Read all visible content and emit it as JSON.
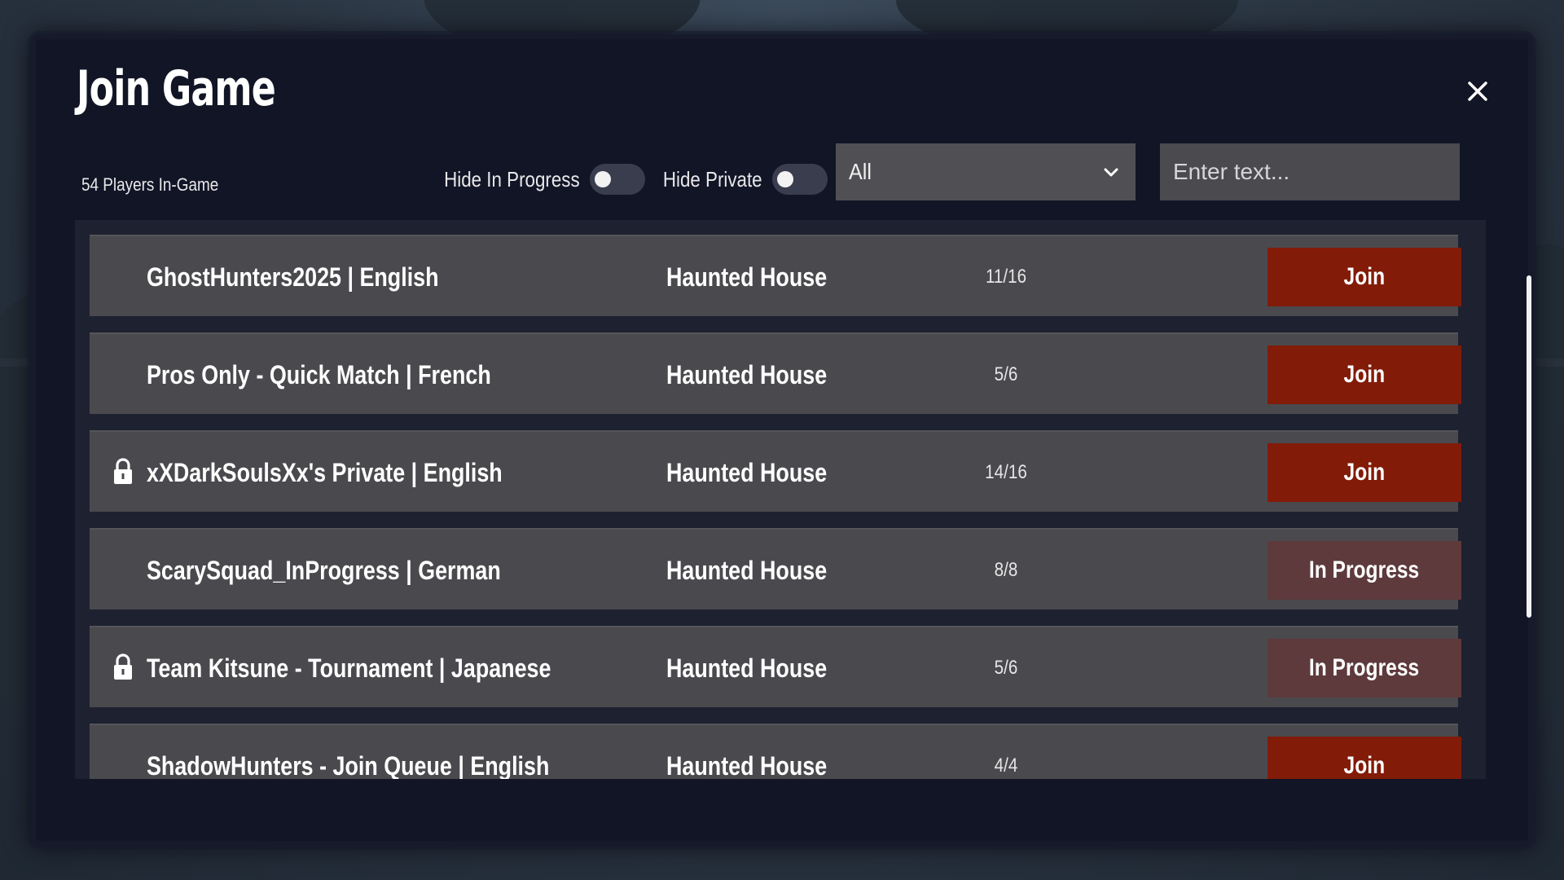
{
  "dialog": {
    "title": "Join Game",
    "players_in_game": "54 Players In-Game"
  },
  "filters": {
    "hide_in_progress_label": "Hide In Progress",
    "hide_in_progress_on": false,
    "hide_private_label": "Hide Private",
    "hide_private_on": false,
    "region_selected": "All",
    "search_placeholder": "Enter text...",
    "search_value": ""
  },
  "icons": {
    "close": "close-icon",
    "dropdown": "chevron-down-icon",
    "private": "lock-icon"
  },
  "colors": {
    "join_button": "#821b08",
    "in_progress_button": "#5e3a3c",
    "row_background": "#4a4a4e",
    "panel_background": "#121526"
  },
  "games": [
    {
      "name": "GhostHunters2025 | English",
      "map": "Haunted House",
      "players": "11/16",
      "private": false,
      "action": "Join",
      "status": "join"
    },
    {
      "name": "Pros Only - Quick Match | French",
      "map": "Haunted House",
      "players": "5/6",
      "private": false,
      "action": "Join",
      "status": "join"
    },
    {
      "name": "xXDarkSoulsXx's Private | English",
      "map": "Haunted House",
      "players": "14/16",
      "private": true,
      "action": "Join",
      "status": "join"
    },
    {
      "name": "ScarySquad_InProgress | German",
      "map": "Haunted House",
      "players": "8/8",
      "private": false,
      "action": "In Progress",
      "status": "progress"
    },
    {
      "name": "Team Kitsune - Tournament | Japanese",
      "map": "Haunted House",
      "players": "5/6",
      "private": true,
      "action": "In Progress",
      "status": "progress"
    },
    {
      "name": "ShadowHunters - Join Queue | English",
      "map": "Haunted House",
      "players": "4/4",
      "private": false,
      "action": "Join",
      "status": "join"
    }
  ]
}
